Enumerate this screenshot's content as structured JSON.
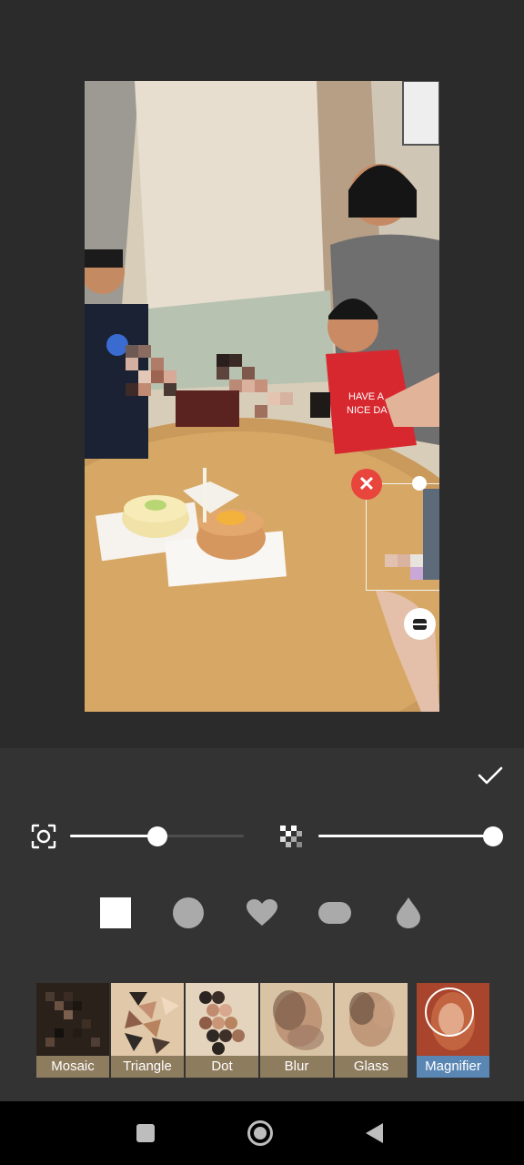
{
  "editor": {
    "confirm_icon": "check-icon",
    "selection": {
      "close_icon": "close-icon",
      "resize_icon": "resize-handle-icon"
    }
  },
  "sliders": [
    {
      "name": "brush-size",
      "icon": "focus-icon",
      "value": 0.5
    },
    {
      "name": "mosaic-intensity",
      "icon": "checker-icon",
      "value": 1.0
    }
  ],
  "shapes": [
    "square",
    "circle",
    "heart",
    "rounded-rect",
    "drop"
  ],
  "effects": [
    {
      "label": "Mosaic",
      "selected": false
    },
    {
      "label": "Triangle",
      "selected": false
    },
    {
      "label": "Dot",
      "selected": false
    },
    {
      "label": "Blur",
      "selected": false
    },
    {
      "label": "Glass",
      "selected": false
    },
    {
      "label": "Magnifier",
      "selected": true
    }
  ],
  "colors": {
    "accent_selected": "#5a86b4",
    "label_bg": "#8e7c5f",
    "close_red": "#e8453c"
  },
  "navbar": {
    "icons": [
      "recents-icon",
      "home-icon",
      "back-icon"
    ]
  }
}
